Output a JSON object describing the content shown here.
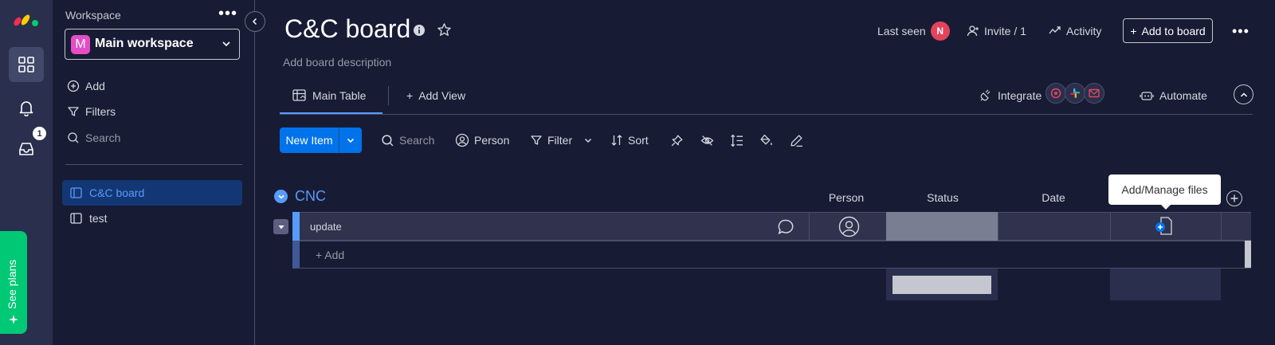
{
  "rail": {
    "notification_count": "1",
    "see_plans": "See plans"
  },
  "workspace": {
    "label": "Workspace",
    "selected": "Main workspace",
    "avatar_letter": "M",
    "actions": {
      "add": "Add",
      "filters": "Filters",
      "search": "Search"
    },
    "boards": [
      "C&C board",
      "test"
    ]
  },
  "header": {
    "title": "C&C board",
    "description": "Add board description",
    "last_seen": "Last seen",
    "last_seen_avatar": "N",
    "invite": "Invite / 1",
    "activity": "Activity",
    "add_to_board": "Add to board"
  },
  "tabs": {
    "main_table": "Main Table",
    "add_view": "Add View",
    "integrate": "Integrate",
    "automate": "Automate"
  },
  "toolbar": {
    "new_item": "New Item",
    "search": "Search",
    "person": "Person",
    "filter": "Filter",
    "sort": "Sort"
  },
  "table": {
    "group_name": "CNC",
    "columns": [
      "Person",
      "Status",
      "Date"
    ],
    "rows": [
      {
        "name": "update"
      }
    ],
    "add_row": "+ Add"
  },
  "tooltip": "Add/Manage files",
  "colors": {
    "accent": "#579bfc",
    "primary_button": "#0073ea",
    "see_plans": "#00c875",
    "background": "#181b34"
  }
}
